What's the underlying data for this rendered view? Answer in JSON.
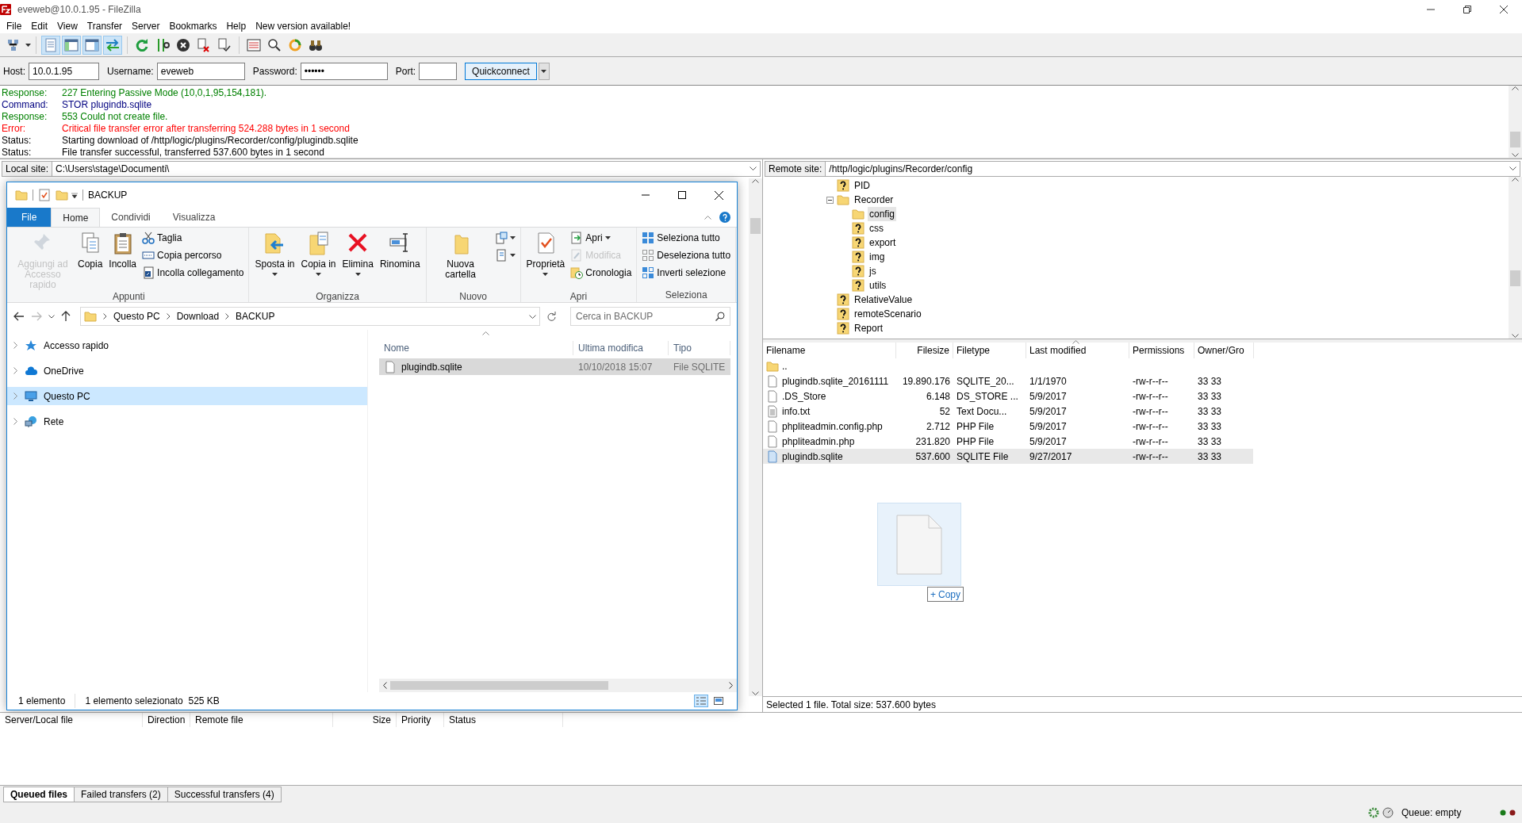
{
  "window": {
    "title": "eveweb@10.0.1.95 - FileZilla"
  },
  "menu": [
    "File",
    "Edit",
    "View",
    "Transfer",
    "Server",
    "Bookmarks",
    "Help",
    "New version available!"
  ],
  "quickconnect": {
    "fields": [
      {
        "label": "Host:",
        "value": "10.0.1.95"
      },
      {
        "label": "Username:",
        "value": "eveweb"
      },
      {
        "label": "Password:",
        "value": "••••••"
      },
      {
        "label": "Port:"
      }
    ],
    "button": "Quickconnect"
  },
  "message_log": [
    {
      "kind": "response",
      "label": "Response:",
      "text": "227 Entering Passive Mode (10,0,1,95,154,181)."
    },
    {
      "kind": "command",
      "label": "Command:",
      "text": "STOR plugindb.sqlite"
    },
    {
      "kind": "response",
      "label": "Response:",
      "text": "553 Could not create file."
    },
    {
      "kind": "error",
      "label": "Error:",
      "text": "Critical file transfer error after transferring 524.288 bytes in 1 second"
    },
    {
      "kind": "status",
      "label": "Status:",
      "text": "Starting download of /http/logic/plugins/Recorder/config/plugindb.sqlite"
    },
    {
      "kind": "status",
      "label": "Status:",
      "text": "File transfer successful, transferred 537.600 bytes in 1 second"
    }
  ],
  "local_site": {
    "label": "Local site:",
    "path": "C:\\Users\\stage\\Documenti\\"
  },
  "remote_site": {
    "label": "Remote site:",
    "path": "/http/logic/plugins/Recorder/config"
  },
  "remote_tree": [
    {
      "name": "PID",
      "kind": "unknown",
      "selected": false,
      "expanded": false
    },
    {
      "name": "Recorder",
      "kind": "folder",
      "selected": false,
      "expanded": true,
      "children": [
        {
          "name": "config",
          "kind": "folder",
          "selected": true,
          "expanded": false
        },
        {
          "name": "css",
          "kind": "unknown",
          "selected": false,
          "expanded": false
        },
        {
          "name": "export",
          "kind": "unknown",
          "selected": false,
          "expanded": false
        },
        {
          "name": "img",
          "kind": "unknown",
          "selected": false,
          "expanded": false
        },
        {
          "name": "js",
          "kind": "unknown",
          "selected": false,
          "expanded": false
        },
        {
          "name": "utils",
          "kind": "unknown",
          "selected": false,
          "expanded": false
        }
      ]
    },
    {
      "name": "RelativeValue",
      "kind": "unknown",
      "selected": false,
      "expanded": false
    },
    {
      "name": "remoteScenario",
      "kind": "unknown",
      "selected": false,
      "expanded": false
    },
    {
      "name": "Report",
      "kind": "unknown",
      "selected": false,
      "expanded": false
    }
  ],
  "remote_files": {
    "columns": [
      "Filename",
      "Filesize",
      "Filetype",
      "Last modified",
      "Permissions",
      "Owner/Gro"
    ],
    "rows": [
      {
        "kind": "folder",
        "selected": false,
        "cells": [
          ".."
        ]
      },
      {
        "kind": "file",
        "selected": false,
        "cells": [
          "plugindb.sqlite_20161111",
          "19.890.176",
          "SQLITE_20...",
          "1/1/1970",
          "-rw-r--r--",
          "33 33"
        ]
      },
      {
        "kind": "file",
        "selected": false,
        "cells": [
          ".DS_Store",
          "6.148",
          "DS_STORE ...",
          "5/9/2017",
          "-rw-r--r--",
          "33 33"
        ]
      },
      {
        "kind": "text",
        "selected": false,
        "cells": [
          "info.txt",
          "52",
          "Text Docu...",
          "5/9/2017",
          "-rw-r--r--",
          "33 33"
        ]
      },
      {
        "kind": "file",
        "selected": false,
        "cells": [
          "phpliteadmin.config.php",
          "2.712",
          "PHP File",
          "5/9/2017",
          "-rw-r--r--",
          "33 33"
        ]
      },
      {
        "kind": "file",
        "selected": false,
        "cells": [
          "phpliteadmin.php",
          "231.820",
          "PHP File",
          "5/9/2017",
          "-rw-r--r--",
          "33 33"
        ]
      },
      {
        "kind": "sqlite",
        "selected": true,
        "cells": [
          "plugindb.sqlite",
          "537.600",
          "SQLITE File",
          "9/27/2017",
          "-rw-r--r--",
          "33 33"
        ]
      }
    ]
  },
  "remote_status": "Selected 1 file. Total size: 537.600 bytes",
  "queue": {
    "columns": [
      "Server/Local file",
      "Direction",
      "Remote file",
      "Size",
      "Priority",
      "Status"
    ],
    "tabs": [
      {
        "label": "Queued files",
        "selected": true
      },
      {
        "label": "Failed transfers (2)",
        "selected": false
      },
      {
        "label": "Successful transfers (4)",
        "selected": false
      }
    ]
  },
  "status_bar": {
    "queue": "Queue: empty"
  },
  "explorer": {
    "title": "BACKUP",
    "ribbon_tabs": [
      {
        "label": "File",
        "kind": "file",
        "selected": false
      },
      {
        "label": "Home",
        "kind": "tab",
        "selected": true
      },
      {
        "label": "Condividi",
        "kind": "tab",
        "selected": false
      },
      {
        "label": "Visualizza",
        "kind": "tab",
        "selected": false
      }
    ],
    "ribbon_groups": [
      {
        "label": "Appunti",
        "commands": [
          {
            "kind": "large",
            "label": "Aggiungi ad Accesso rapido",
            "disabled": true
          },
          {
            "kind": "large",
            "label": "Copia",
            "disabled": false
          },
          {
            "kind": "large",
            "label": "Incolla",
            "disabled": false
          },
          {
            "kind": "small",
            "label": "Taglia",
            "disabled": false
          },
          {
            "kind": "small",
            "label": "Copia percorso",
            "disabled": false
          },
          {
            "kind": "small",
            "label": "Incolla collegamento",
            "disabled": false
          }
        ]
      },
      {
        "label": "Organizza",
        "commands": [
          {
            "kind": "large",
            "label": "Sposta in",
            "disabled": false,
            "dropdown": true
          },
          {
            "kind": "large",
            "label": "Copia in",
            "disabled": false,
            "dropdown": true
          },
          {
            "kind": "large",
            "label": "Elimina",
            "disabled": false,
            "dropdown": true
          },
          {
            "kind": "large",
            "label": "Rinomina",
            "disabled": false
          }
        ]
      },
      {
        "label": "Nuovo",
        "commands": [
          {
            "kind": "large",
            "label": "Nuova cartella",
            "disabled": false
          },
          {
            "kind": "icon",
            "disabled": false,
            "dropdown": true
          },
          {
            "kind": "icon",
            "disabled": false,
            "dropdown": true
          }
        ]
      },
      {
        "label": "Apri",
        "commands": [
          {
            "kind": "large",
            "label": "Proprietà",
            "disabled": false,
            "dropdown": true
          },
          {
            "kind": "small",
            "label": "Apri",
            "disabled": false,
            "dropdown": true
          },
          {
            "kind": "small",
            "label": "Modifica",
            "disabled": true
          },
          {
            "kind": "small",
            "label": "Cronologia",
            "disabled": false
          }
        ]
      },
      {
        "label": "Seleziona",
        "commands": [
          {
            "kind": "small",
            "label": "Seleziona tutto",
            "disabled": false
          },
          {
            "kind": "small",
            "label": "Deseleziona tutto",
            "disabled": false
          },
          {
            "kind": "small",
            "label": "Inverti selezione",
            "disabled": false
          }
        ]
      }
    ],
    "breadcrumb": [
      "Questo PC",
      "Download",
      "BACKUP"
    ],
    "search": {
      "placeholder": "Cerca in BACKUP"
    },
    "nav": [
      {
        "label": "Accesso rapido",
        "selected": false
      },
      {
        "label": "OneDrive",
        "selected": false
      },
      {
        "label": "Questo PC",
        "selected": true
      },
      {
        "label": "Rete",
        "selected": false
      }
    ],
    "columns": [
      "Nome",
      "Ultima modifica",
      "Tipo"
    ],
    "files": [
      {
        "selected": true,
        "cells": [
          "plugindb.sqlite",
          "10/10/2018 15:07",
          "File SQLITE"
        ]
      }
    ],
    "status": [
      "1 elemento",
      "1 elemento selezionato  525 KB"
    ]
  },
  "drag": {
    "symbol": "+",
    "label": "Copy"
  }
}
